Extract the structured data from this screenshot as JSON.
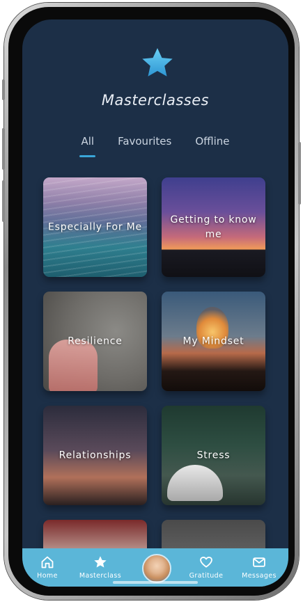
{
  "header": {
    "title": "Masterclasses"
  },
  "tabs": [
    {
      "label": "All",
      "active": true
    },
    {
      "label": "Favourites",
      "active": false
    },
    {
      "label": "Offline",
      "active": false
    }
  ],
  "cards": [
    {
      "label": "Especially For Me"
    },
    {
      "label": "Getting to know me"
    },
    {
      "label": "Resilience"
    },
    {
      "label": "My Mindset"
    },
    {
      "label": "Relationships"
    },
    {
      "label": "Stress"
    },
    {
      "label": ""
    },
    {
      "label": ""
    }
  ],
  "nav": {
    "home": "Home",
    "masterclass": "Masterclass",
    "gratitude": "Gratitude",
    "messages": "Messages"
  },
  "colors": {
    "background": "#1c2f47",
    "accent": "#3aa6d8",
    "tabbar": "#5bb6d8"
  },
  "icons": [
    "star-icon",
    "home-icon",
    "star-icon",
    "heart-icon",
    "mail-icon"
  ]
}
